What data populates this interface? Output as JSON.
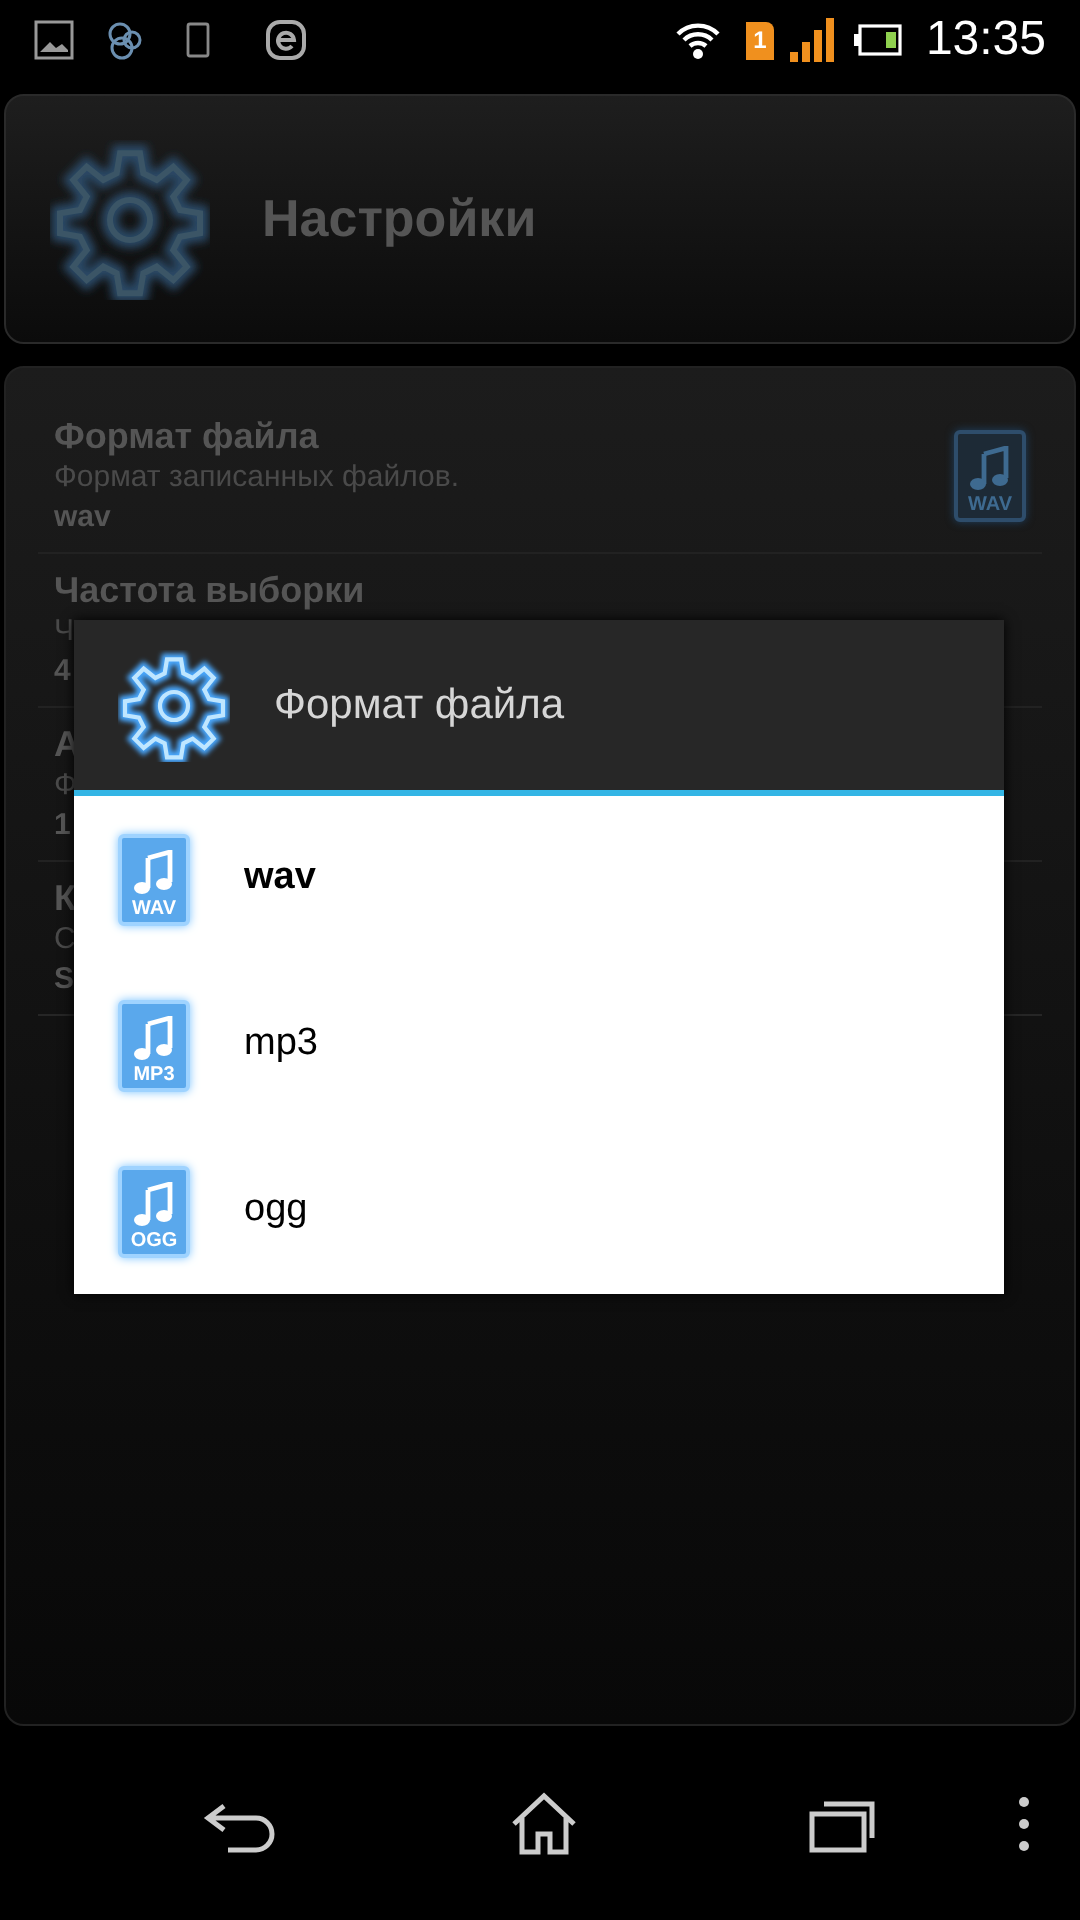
{
  "status_bar": {
    "sim_badge": "1",
    "time": "13:35"
  },
  "header": {
    "title": "Настройки"
  },
  "settings": [
    {
      "title": "Формат файла",
      "summary": "Формат записанных файлов.",
      "value": "wav",
      "icon_label": "WAV"
    },
    {
      "title": "Частота выборки",
      "summary": "Ч",
      "value": "4"
    },
    {
      "title": "А",
      "summary": "Ф",
      "value": "1"
    },
    {
      "title": "К",
      "summary": "С",
      "value": "S"
    }
  ],
  "dialog": {
    "title": "Формат файла",
    "options": [
      {
        "label": "wav",
        "icon_label": "WAV",
        "selected": true
      },
      {
        "label": "mp3",
        "icon_label": "MP3",
        "selected": false
      },
      {
        "label": "ogg",
        "icon_label": "OGG",
        "selected": false
      }
    ]
  }
}
